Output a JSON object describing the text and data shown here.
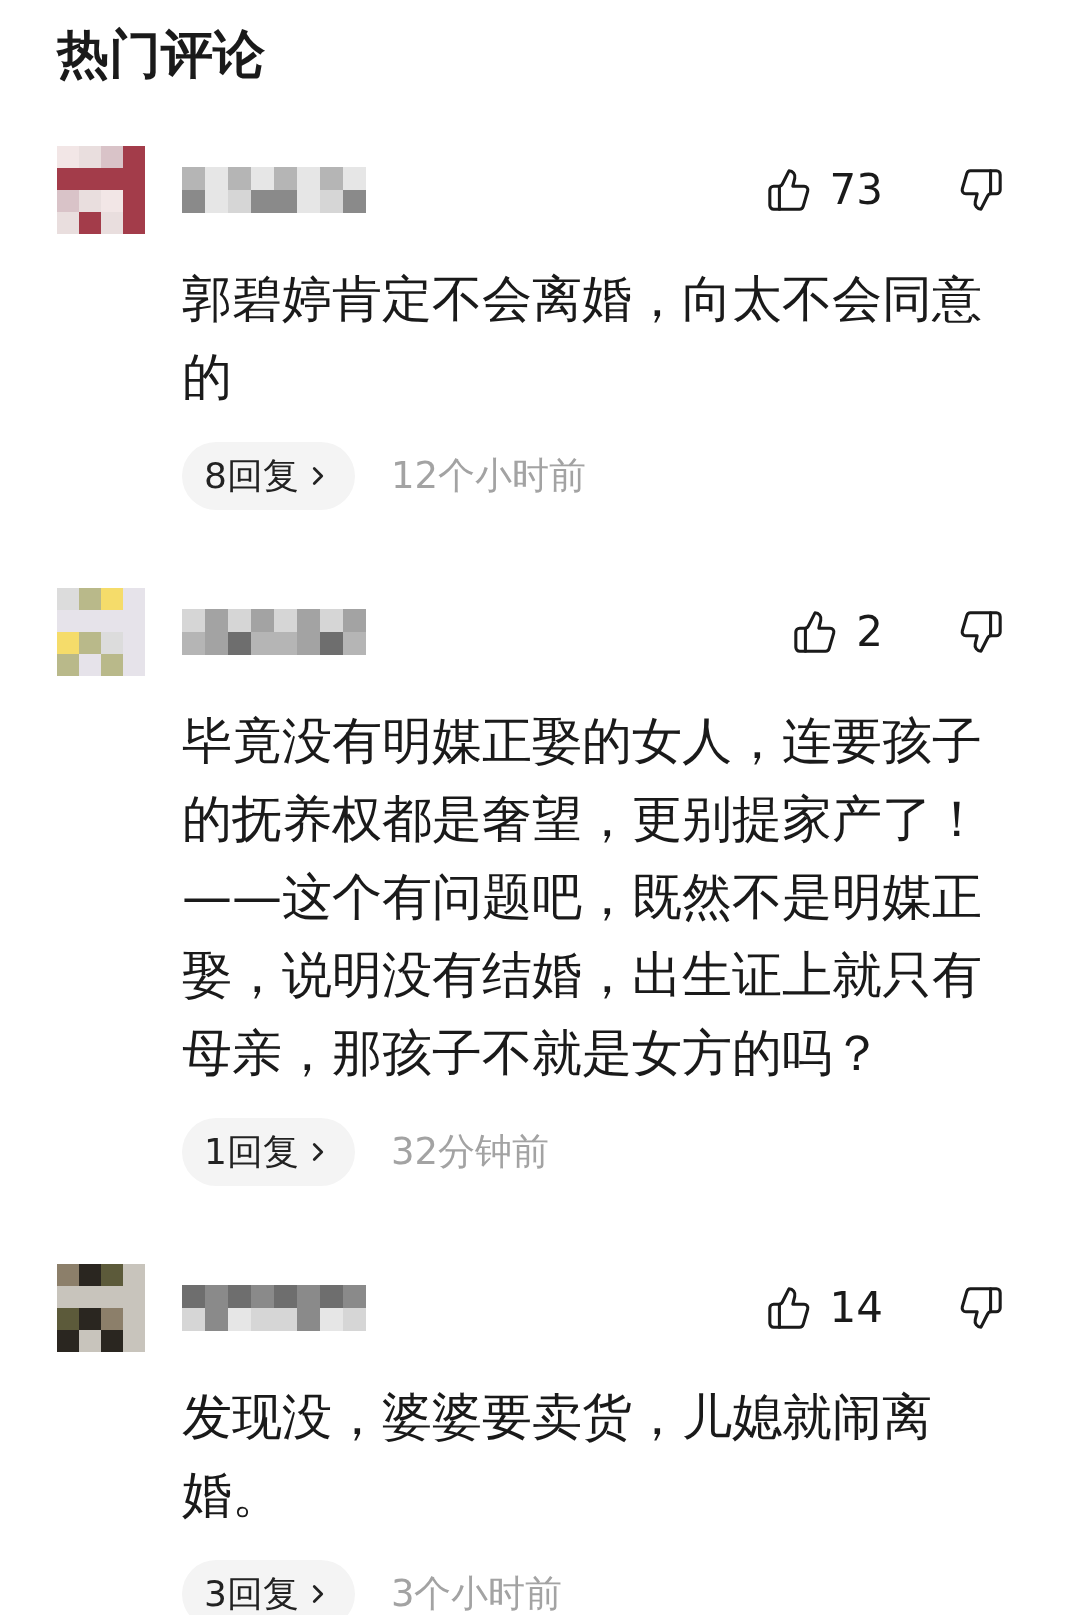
{
  "section_title": "热门评论",
  "comments": [
    {
      "likes": "73",
      "text": "郭碧婷肯定不会离婚，向太不会同意的",
      "replies": "8回复",
      "time": "12个小时前"
    },
    {
      "likes": "2",
      "text": "毕竟没有明媒正娶的女人，连要孩子的抚养权都是奢望，更别提家产了！——这个有问题吧，既然不是明媒正娶，说明没有结婚，出生证上就只有母亲，那孩子不就是女方的吗？",
      "replies": "1回复",
      "time": "32分钟前"
    },
    {
      "likes": "14",
      "text": "发现没，婆婆要卖货，儿媳就闹离婚。",
      "replies": "3回复",
      "time": "3个小时前"
    }
  ]
}
